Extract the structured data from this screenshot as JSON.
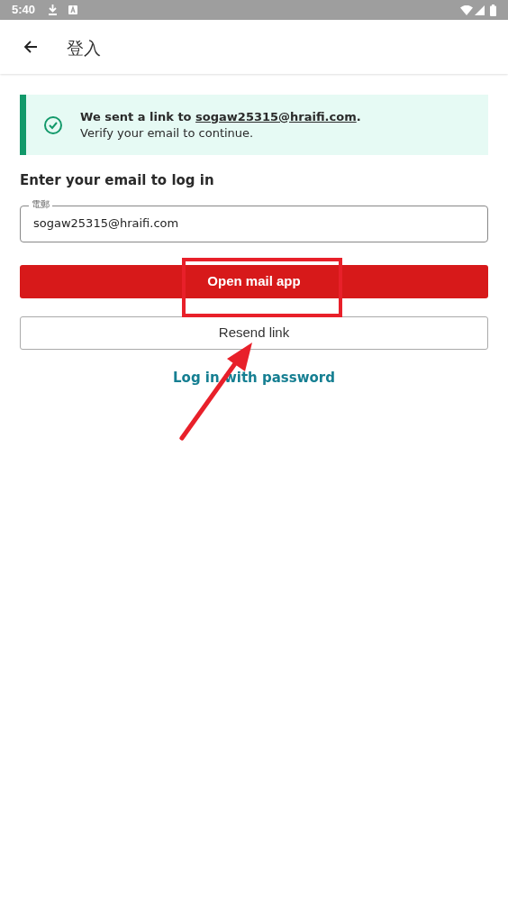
{
  "status_bar": {
    "time": "5:40"
  },
  "app_bar": {
    "title": "登入"
  },
  "banner": {
    "prefix": "We sent a link to",
    "email": "sogaw25315@hraifi.com",
    "suffix": ".",
    "detail": "Verify your email to continue."
  },
  "heading": "Enter your email to log in",
  "email_field": {
    "label": "電郵",
    "value": "sogaw25315@hraifi.com"
  },
  "buttons": [
    {
      "kind": "primary",
      "label": "Open mail app"
    },
    {
      "kind": "outline",
      "label": "Resend link"
    }
  ],
  "link": "Log in with password"
}
